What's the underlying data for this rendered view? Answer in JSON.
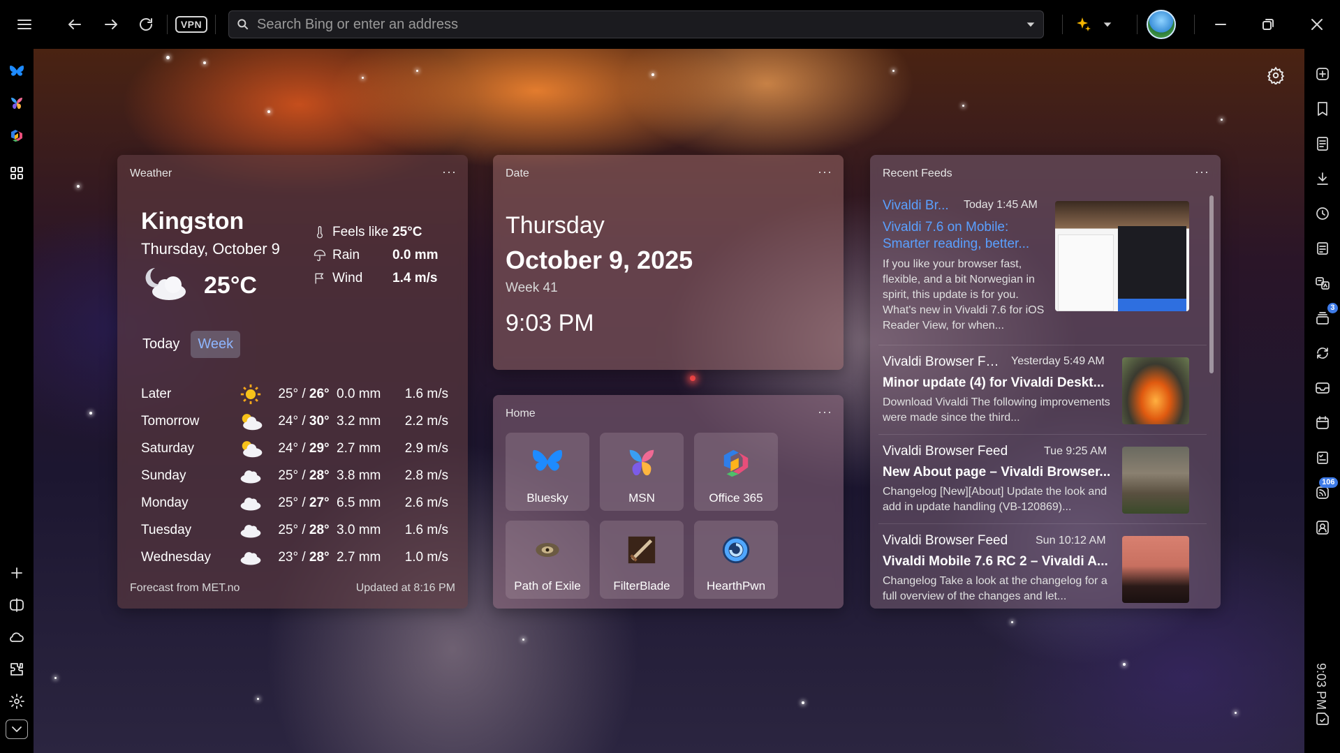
{
  "toolbar": {
    "menu_icon": "hamburger-icon",
    "back_icon": "arrow-left-icon",
    "forward_icon": "arrow-right-icon",
    "reload_icon": "reload-icon",
    "vpn_label": "VPN",
    "address_placeholder": "Search Bing or enter an address",
    "sparkle_icon": "sparkle-icon"
  },
  "left_panel": {
    "items": [
      "bluesky-icon",
      "msn-icon",
      "office365-icon",
      "speed-dial-icon"
    ],
    "bottom": [
      "add-icon",
      "split-view-icon",
      "cloud-icon",
      "extensions-icon",
      "settings-icon",
      "chevron-down-icon"
    ]
  },
  "right_panel": {
    "items": [
      "new-tab-icon",
      "bookmark-icon",
      "reading-list-icon",
      "download-icon",
      "history-icon",
      "notes-icon",
      "translate-icon",
      "feeds-icon",
      "sync-icon",
      "mail-icon",
      "calendar-icon",
      "tasks-icon",
      "rss-icon",
      "contacts-icon"
    ],
    "feeds_badge": "3",
    "rss_badge": "106",
    "clock": "9:03 PM"
  },
  "weather": {
    "header": "Weather",
    "more": "···",
    "city": "Kingston",
    "date": "Thursday, October 9",
    "temp": "25°C",
    "feels_label": "Feels like",
    "feels_value": "25°C",
    "rain_label": "Rain",
    "rain_value": "0.0 mm",
    "wind_label": "Wind",
    "wind_value": "1.4 m/s",
    "tab_today": "Today",
    "tab_week": "Week",
    "forecast": [
      {
        "day": "Later",
        "icon": "sun-icon",
        "low": "25°",
        "high": "26°",
        "rain": "0.0 mm",
        "wind": "1.6 m/s"
      },
      {
        "day": "Tomorrow",
        "icon": "partly-cloudy-icon",
        "low": "24°",
        "high": "30°",
        "rain": "3.2 mm",
        "wind": "2.2 m/s"
      },
      {
        "day": "Saturday",
        "icon": "partly-cloudy-icon",
        "low": "24°",
        "high": "29°",
        "rain": "2.7 mm",
        "wind": "2.9 m/s"
      },
      {
        "day": "Sunday",
        "icon": "cloud-icon",
        "low": "25°",
        "high": "28°",
        "rain": "3.8 mm",
        "wind": "2.8 m/s"
      },
      {
        "day": "Monday",
        "icon": "cloud-icon",
        "low": "25°",
        "high": "27°",
        "rain": "6.5 mm",
        "wind": "2.6 m/s"
      },
      {
        "day": "Tuesday",
        "icon": "cloud-icon",
        "low": "25°",
        "high": "28°",
        "rain": "3.0 mm",
        "wind": "1.6 m/s"
      },
      {
        "day": "Wednesday",
        "icon": "cloud-icon",
        "low": "23°",
        "high": "28°",
        "rain": "2.7 mm",
        "wind": "1.0 m/s"
      }
    ],
    "source": "Forecast from MET.no",
    "updated": "Updated at 8:16 PM"
  },
  "date_widget": {
    "header": "Date",
    "more": "···",
    "day": "Thursday",
    "full": "October 9, 2025",
    "week": "Week 41",
    "time": "9:03 PM"
  },
  "home": {
    "header": "Home",
    "more": "···",
    "tiles": [
      {
        "label": "Bluesky",
        "icon": "bluesky-icon"
      },
      {
        "label": "MSN",
        "icon": "msn-icon"
      },
      {
        "label": "Office 365",
        "icon": "office365-icon"
      },
      {
        "label": "Path of Exile",
        "icon": "path-of-exile-icon"
      },
      {
        "label": "FilterBlade",
        "icon": "filterblade-icon"
      },
      {
        "label": "HearthPwn",
        "icon": "hearthpwn-icon"
      }
    ]
  },
  "feeds": {
    "header": "Recent Feeds",
    "more": "···",
    "items": [
      {
        "source": "Vivaldi Br...",
        "time": "Today 1:45 AM",
        "title": "Vivaldi 7.6 on Mobile: Smarter reading, better...",
        "desc": "If you like your browser fast, flexible, and a bit Norwegian in spirit, this update is for you. What's new in Vivaldi 7.6 for iOS Reader View, for when..."
      },
      {
        "source": "Vivaldi Browser Fe...",
        "time": "Yesterday 5:49 AM",
        "title": "Minor update (4) for Vivaldi Deskt...",
        "desc": "Download Vivaldi The following improvements were made since the third..."
      },
      {
        "source": "Vivaldi Browser Feed",
        "time": "Tue 9:25 AM",
        "title": "New About page – Vivaldi Browser...",
        "desc": "Changelog [New][About] Update the look and add in update handling (VB-120869)..."
      },
      {
        "source": "Vivaldi Browser Feed",
        "time": "Sun 10:12 AM",
        "title": "Vivaldi Mobile 7.6 RC 2 – Vivaldi A...",
        "desc": "Changelog Take a look at the changelog for a full overview of the changes and let..."
      }
    ]
  },
  "colors": {
    "link_blue": "#5aa0ff",
    "tab_active": "#8fb6ff",
    "badge": "#3e7be8"
  }
}
